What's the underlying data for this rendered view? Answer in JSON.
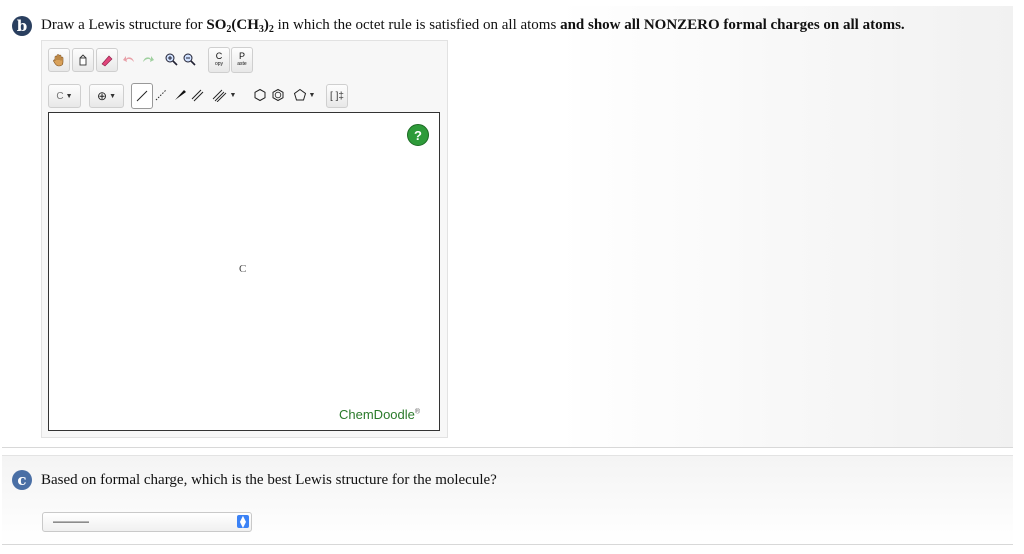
{
  "part_b": {
    "badge": "b",
    "question_pre": "Draw a Lewis structure for ",
    "formula": {
      "so": "SO",
      "sub2": "2",
      "ch": "(CH",
      "sub3": "3",
      "close": ")",
      "sub2b": "2"
    },
    "question_mid": " in which the octet rule is satisfied on all atoms ",
    "question_bold": "and show all NONZERO formal charges on all atoms."
  },
  "toolbar": {
    "row1": [
      {
        "name": "pan-hand-icon"
      },
      {
        "name": "clear-icon"
      },
      {
        "name": "eraser-icon"
      },
      {
        "name": "undo-icon"
      },
      {
        "name": "redo-icon"
      },
      {
        "name": "zoom-in-icon"
      },
      {
        "name": "zoom-out-icon"
      }
    ],
    "copy_top": "C",
    "copy_bottom": "opy",
    "paste_top": "P",
    "paste_bottom": "aste",
    "atom_label": "C",
    "charge_symbol": "⊕",
    "brackets_label": "[ ]‡"
  },
  "canvas": {
    "help_label": "?",
    "atom_label": "C",
    "watermark": "ChemDoodle",
    "watermark_reg": "®"
  },
  "part_c": {
    "badge": "c",
    "question": "Based on formal charge, which is the best Lewis structure for the molecule?",
    "select_value": "———",
    "select_arrows": "▲▼"
  },
  "colors": {
    "badge_b": "#2a3f5f",
    "badge_c": "#4a6fa5",
    "help_green": "#2e9b3a",
    "watermark_green": "#2a7a2a",
    "select_accent": "#3b82f6"
  }
}
